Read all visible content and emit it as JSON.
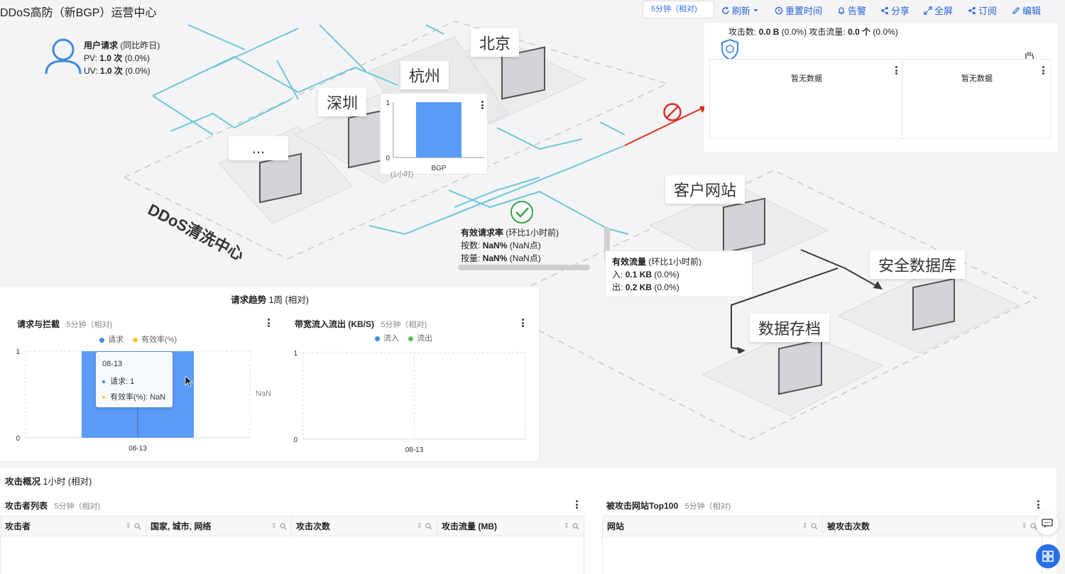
{
  "header": {
    "title": "DDoS高防（新BGP）运营中心",
    "time_range": "5分钟（相对)",
    "toolbar": [
      {
        "icon": "refresh-icon",
        "label": "刷新"
      },
      {
        "icon": "history-icon",
        "label": "重置时间"
      },
      {
        "icon": "bell-icon",
        "label": "告警"
      },
      {
        "icon": "share-icon",
        "label": "分享"
      },
      {
        "icon": "fullscreen-icon",
        "label": "全屏"
      },
      {
        "icon": "subscribe-icon",
        "label": "订阅"
      },
      {
        "icon": "edit-icon",
        "label": "编辑"
      }
    ]
  },
  "user_request": {
    "title": "用户请求",
    "compare": "(同比昨日)",
    "pv_label": "PV:",
    "pv_value": "1.0 次",
    "pv_change": "(0.0%)",
    "uv_label": "UV:",
    "uv_value": "1.0 次",
    "uv_change": "(0.0%)"
  },
  "topology": {
    "cities": [
      "北京",
      "杭州",
      "深圳",
      "..."
    ],
    "center_label": "DDoS清洗中心",
    "customer_site": "客户网站",
    "security_db": "安全数据库",
    "data_archive": "数据存档"
  },
  "mini_chart": {
    "chart_data": {
      "type": "bar",
      "categories": [
        "BGP"
      ],
      "values": [
        1
      ],
      "ylim": [
        0,
        1
      ],
      "yticks": [
        "1",
        "0"
      ],
      "xlabel": "(1小时)"
    }
  },
  "attack_panel": {
    "attack_count_label": "攻击数:",
    "attack_count_value": "0.0 B",
    "attack_count_change": "(0.0%)",
    "attack_traffic_label": "攻击流量:",
    "attack_traffic_value": "0.0 个",
    "attack_traffic_change": "(0.0%)",
    "no_data_1": "暂无数据",
    "no_data_2": "暂无数据"
  },
  "valid_request": {
    "title": "有效请求率",
    "compare": "(环比1小时前)",
    "count_label": "按数:",
    "count_value": "NaN%",
    "count_change": "(NaN点)",
    "volume_label": "按量:",
    "volume_value": "NaN%",
    "volume_change": "(NaN点)"
  },
  "valid_traffic": {
    "title": "有效流量",
    "compare": "(环比1小时前)",
    "in_label": "入:",
    "in_value": "0.1 KB",
    "in_change": "(0.0%)",
    "out_label": "出:",
    "out_value": "0.2 KB",
    "out_change": "(0.0%)"
  },
  "trend_section": {
    "title": "请求趋势",
    "range": "1周 (相对)",
    "chart1": {
      "title": "请求与拦截",
      "range": "5分钟（相对)",
      "right_axis_label": "NaN",
      "chart_data": {
        "type": "bar",
        "categories": [
          "08-13"
        ],
        "series": [
          {
            "name": "请求",
            "values": [
              1
            ],
            "color": "#5b9bf8"
          },
          {
            "name": "有效率(%)",
            "values": [
              null
            ],
            "color": "#f5c842"
          }
        ],
        "ylim": [
          0,
          1
        ],
        "yticks": [
          "1",
          "0"
        ]
      },
      "tooltip": {
        "date": "08-13",
        "rows": [
          {
            "label": "请求: 1"
          },
          {
            "label": "有效率(%): NaN"
          }
        ]
      }
    },
    "chart2": {
      "title": "带宽流入流出 (KB/S)",
      "range": "5分钟（相对)",
      "chart_data": {
        "type": "line",
        "categories": [
          "08-13"
        ],
        "series": [
          {
            "name": "流入",
            "values": [],
            "color": "#5b9bf8"
          },
          {
            "name": "流出",
            "values": [],
            "color": "#54c35b"
          }
        ],
        "ylim": [
          0,
          1
        ],
        "yticks": [
          "1",
          "0"
        ]
      }
    }
  },
  "attack_overview": {
    "title": "攻击概况",
    "range": "1小时 (相对)",
    "attacker_table": {
      "title": "攻击者列表",
      "range": "5分钟（相对)",
      "columns": [
        "攻击者",
        "国家, 城市, 网络",
        "攻击次数",
        "攻击流量 (MB)"
      ]
    },
    "site_table": {
      "title": "被攻击网站Top100",
      "range": "5分钟（相对)",
      "columns": [
        "网站",
        "被攻击次数"
      ]
    }
  }
}
